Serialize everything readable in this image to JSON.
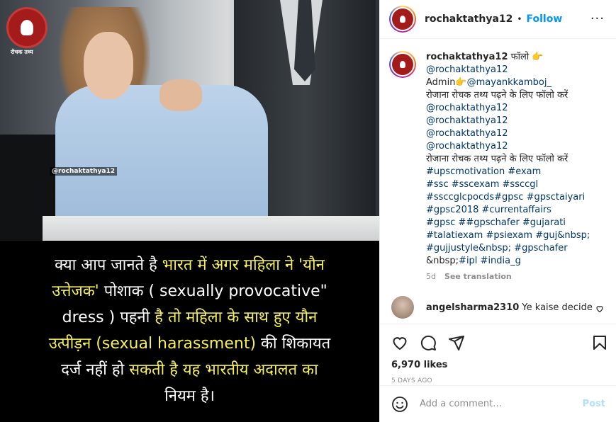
{
  "post_image": {
    "logo_caption": "रोचक तथ्य",
    "watermark": "@rochaktathya12",
    "caption_lines": [
      [
        {
          "t": "क्या आप जानते है ",
          "y": false
        },
        {
          "t": "भारत में अगर महिला ने 'यौन",
          "y": true
        }
      ],
      [
        {
          "t": "उत्तेजक'",
          "y": true
        },
        {
          "t": " पोशाक ( sexually provocative\"",
          "y": false
        }
      ],
      [
        {
          "t": "dress )  पहनी ",
          "y": false
        },
        {
          "t": "है तो महिला के साथ हुए यौन",
          "y": true
        }
      ],
      [
        {
          "t": "उत्पीड़न (sexual harassment)",
          "y": true
        },
        {
          "t": " की शिकायत",
          "y": false
        }
      ],
      [
        {
          "t": "दर्ज नहीं हो ",
          "y": false
        },
        {
          "t": "सकती है यह भारतीय अदालत का",
          "y": true
        }
      ],
      [
        {
          "t": "नियम है।",
          "y": false
        }
      ]
    ]
  },
  "header": {
    "username": "rochaktathya12",
    "separator": "•",
    "follow_label": "Follow",
    "more_label": "···"
  },
  "caption": {
    "username": "rochaktathya12",
    "first_text": " फॉलो 👉",
    "lines": [
      {
        "kind": "link",
        "text": "@rochaktathya12"
      },
      {
        "kind": "mixed",
        "pre": "Admin👉",
        "link": "@mayankkamboj_"
      },
      {
        "kind": "text",
        "text": "रोजाना रोचक तथ्य पढ़ने के लिए फॉलो करें"
      },
      {
        "kind": "link",
        "text": "@rochaktathya12"
      },
      {
        "kind": "link",
        "text": "@rochaktathya12"
      },
      {
        "kind": "link",
        "text": "@rochaktathya12"
      },
      {
        "kind": "link",
        "text": "@rochaktathya12"
      },
      {
        "kind": "text",
        "text": "रोजाना रोचक तथ्य पढ़ने के लिए फॉलो करें"
      },
      {
        "kind": "link",
        "text": "#upscmotivation #exam"
      },
      {
        "kind": "link",
        "text": "#ssc #sscexam #ssccgl"
      },
      {
        "kind": "link",
        "text": "#ssccglcpocds#gpsc #gpsctaiyari"
      },
      {
        "kind": "link",
        "text": "#gpsc2018 #currentaffairs"
      },
      {
        "kind": "link",
        "text": "#gpsc ##gpschafer #gujarati"
      },
      {
        "kind": "link",
        "text": "#talatiexam #psiexam #guj&nbsp;"
      },
      {
        "kind": "link",
        "text": "#gujjustyle&nbsp; #gpschafer"
      },
      {
        "kind": "mixed",
        "pre": "&nbsp;",
        "link": "#ipl #india_g"
      }
    ],
    "age": "5d",
    "see_translation": "See translation"
  },
  "comment": {
    "username": "angelsharma2310",
    "text": " Ye kaise decide"
  },
  "actions": {
    "likes": "6,970 likes",
    "time": "5 DAYS AGO"
  },
  "add_comment": {
    "placeholder": "Add a comment…",
    "post_label": "Post"
  },
  "colors": {
    "link": "#00376b",
    "follow": "#0095f6",
    "caption_yellow": "#f5ef5a",
    "brand_red": "#a31b1b"
  }
}
